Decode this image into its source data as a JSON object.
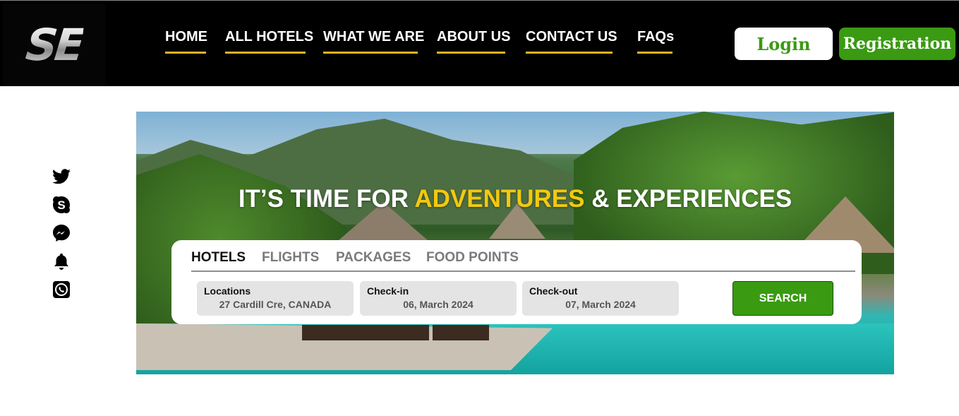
{
  "brand": {
    "logo_text": "SE"
  },
  "nav": {
    "items": [
      {
        "label": "HOME"
      },
      {
        "label": "ALL HOTELS"
      },
      {
        "label": "WHAT WE ARE"
      },
      {
        "label": "ABOUT US"
      },
      {
        "label": "CONTACT US"
      },
      {
        "label": "FAQs"
      }
    ],
    "underline_color": "#e2b227"
  },
  "auth": {
    "login_label": "Login",
    "register_label": "Registration",
    "accent": "#3a9a12"
  },
  "socials": [
    "twitter-icon",
    "skype-icon",
    "messenger-icon",
    "bell-icon",
    "whatsapp-icon"
  ],
  "hero": {
    "title_before": "IT’S TIME FOR ",
    "title_accent": "ADVENTURES",
    "title_after": " & EXPERIENCES",
    "accent_color": "#f3c90e"
  },
  "search": {
    "tabs": [
      {
        "label": "HOTELS",
        "active": true
      },
      {
        "label": "FLIGHTS",
        "active": false
      },
      {
        "label": "PACKAGES",
        "active": false
      },
      {
        "label": "FOOD POINTS",
        "active": false
      }
    ],
    "fields": [
      {
        "label": "Locations",
        "value": "27 Cardill Cre, CANADA"
      },
      {
        "label": "Check-in",
        "value": "06, March 2024"
      },
      {
        "label": "Check-out",
        "value": "07, March 2024"
      }
    ],
    "button_label": "SEARCH"
  }
}
